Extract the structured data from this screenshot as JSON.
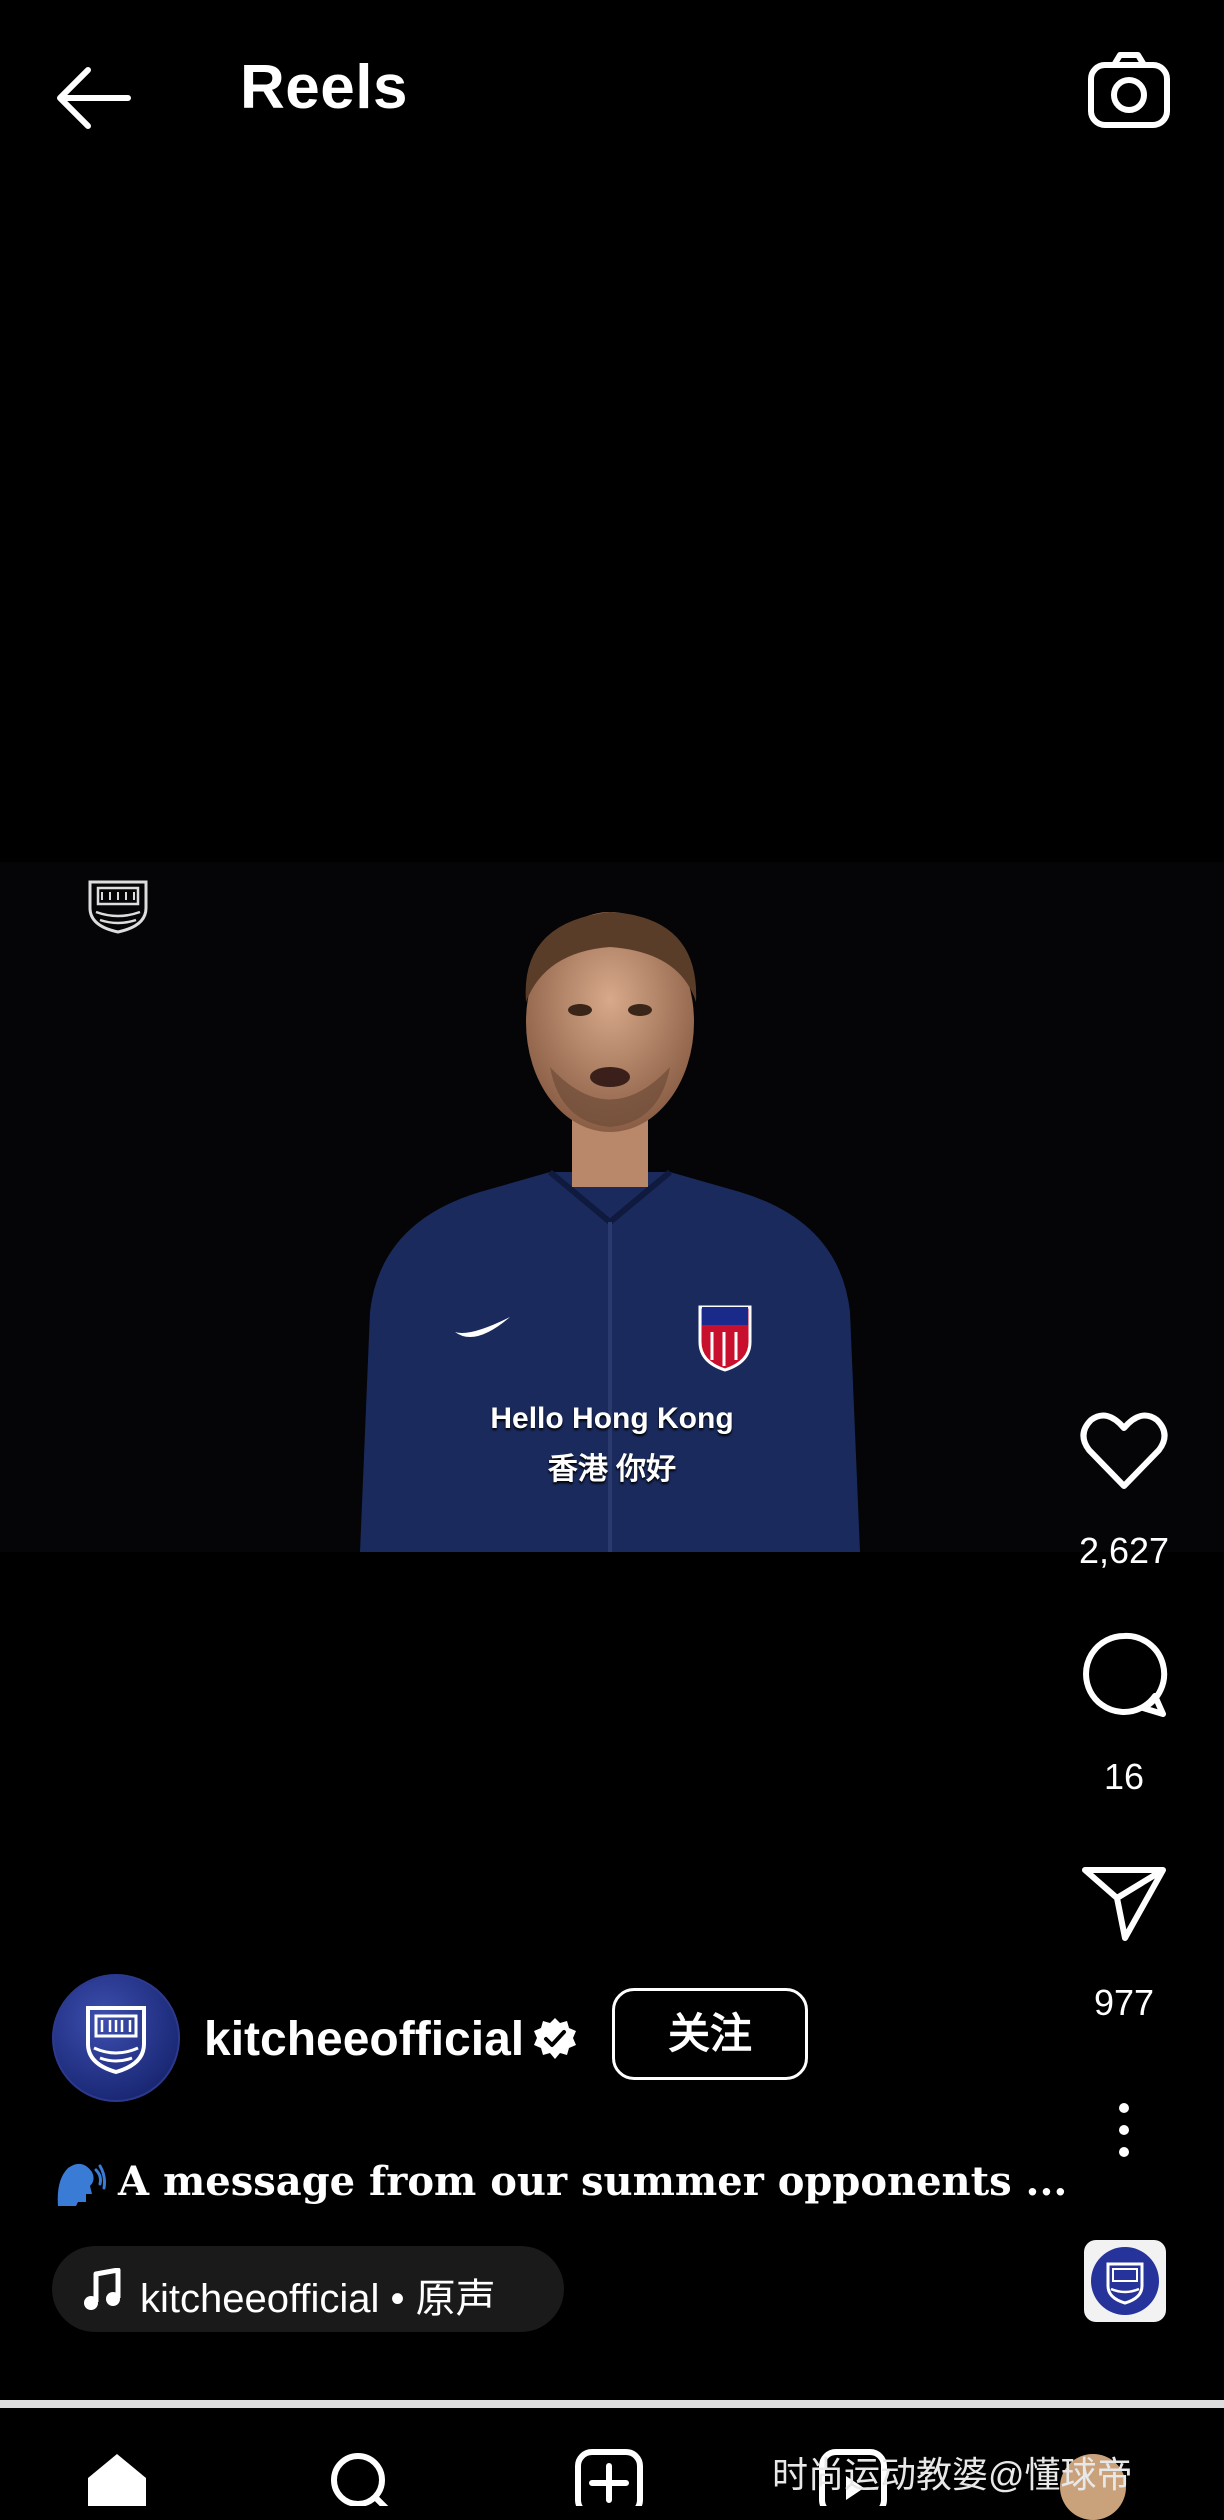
{
  "header": {
    "title": "Reels",
    "back_icon": "arrow-left-icon",
    "camera_icon": "camera-icon"
  },
  "video": {
    "subtitle_en": "Hello Hong Kong",
    "subtitle_cn": "香港 你好",
    "logo_icon": "kitchee-logo-icon"
  },
  "actions": {
    "likes": "2,627",
    "comments": "16",
    "shares": "977",
    "like_icon": "heart-icon",
    "comment_icon": "comment-icon",
    "share_icon": "send-icon",
    "more_icon": "more-vertical-icon"
  },
  "owner": {
    "username": "kitcheeofficial",
    "verified_icon": "verified-badge-icon",
    "follow_label": "关注"
  },
  "caption": {
    "text": "A message from our summer opponents ...",
    "icon": "speaking-head-icon"
  },
  "audio": {
    "text": "kitcheeofficial • 原声",
    "icon": "music-note-icon"
  },
  "progress": {
    "fraction": 1.0
  },
  "bottom_nav": {
    "items": [
      "home-icon",
      "search-icon",
      "create-icon",
      "reels-icon",
      "profile-avatar"
    ],
    "watermark": "时尚运动教婆@懂球帝"
  },
  "colors": {
    "background": "#000000",
    "text": "#ffffff",
    "pill": "#1a1a1a",
    "jacket": "#1a2a5c"
  }
}
